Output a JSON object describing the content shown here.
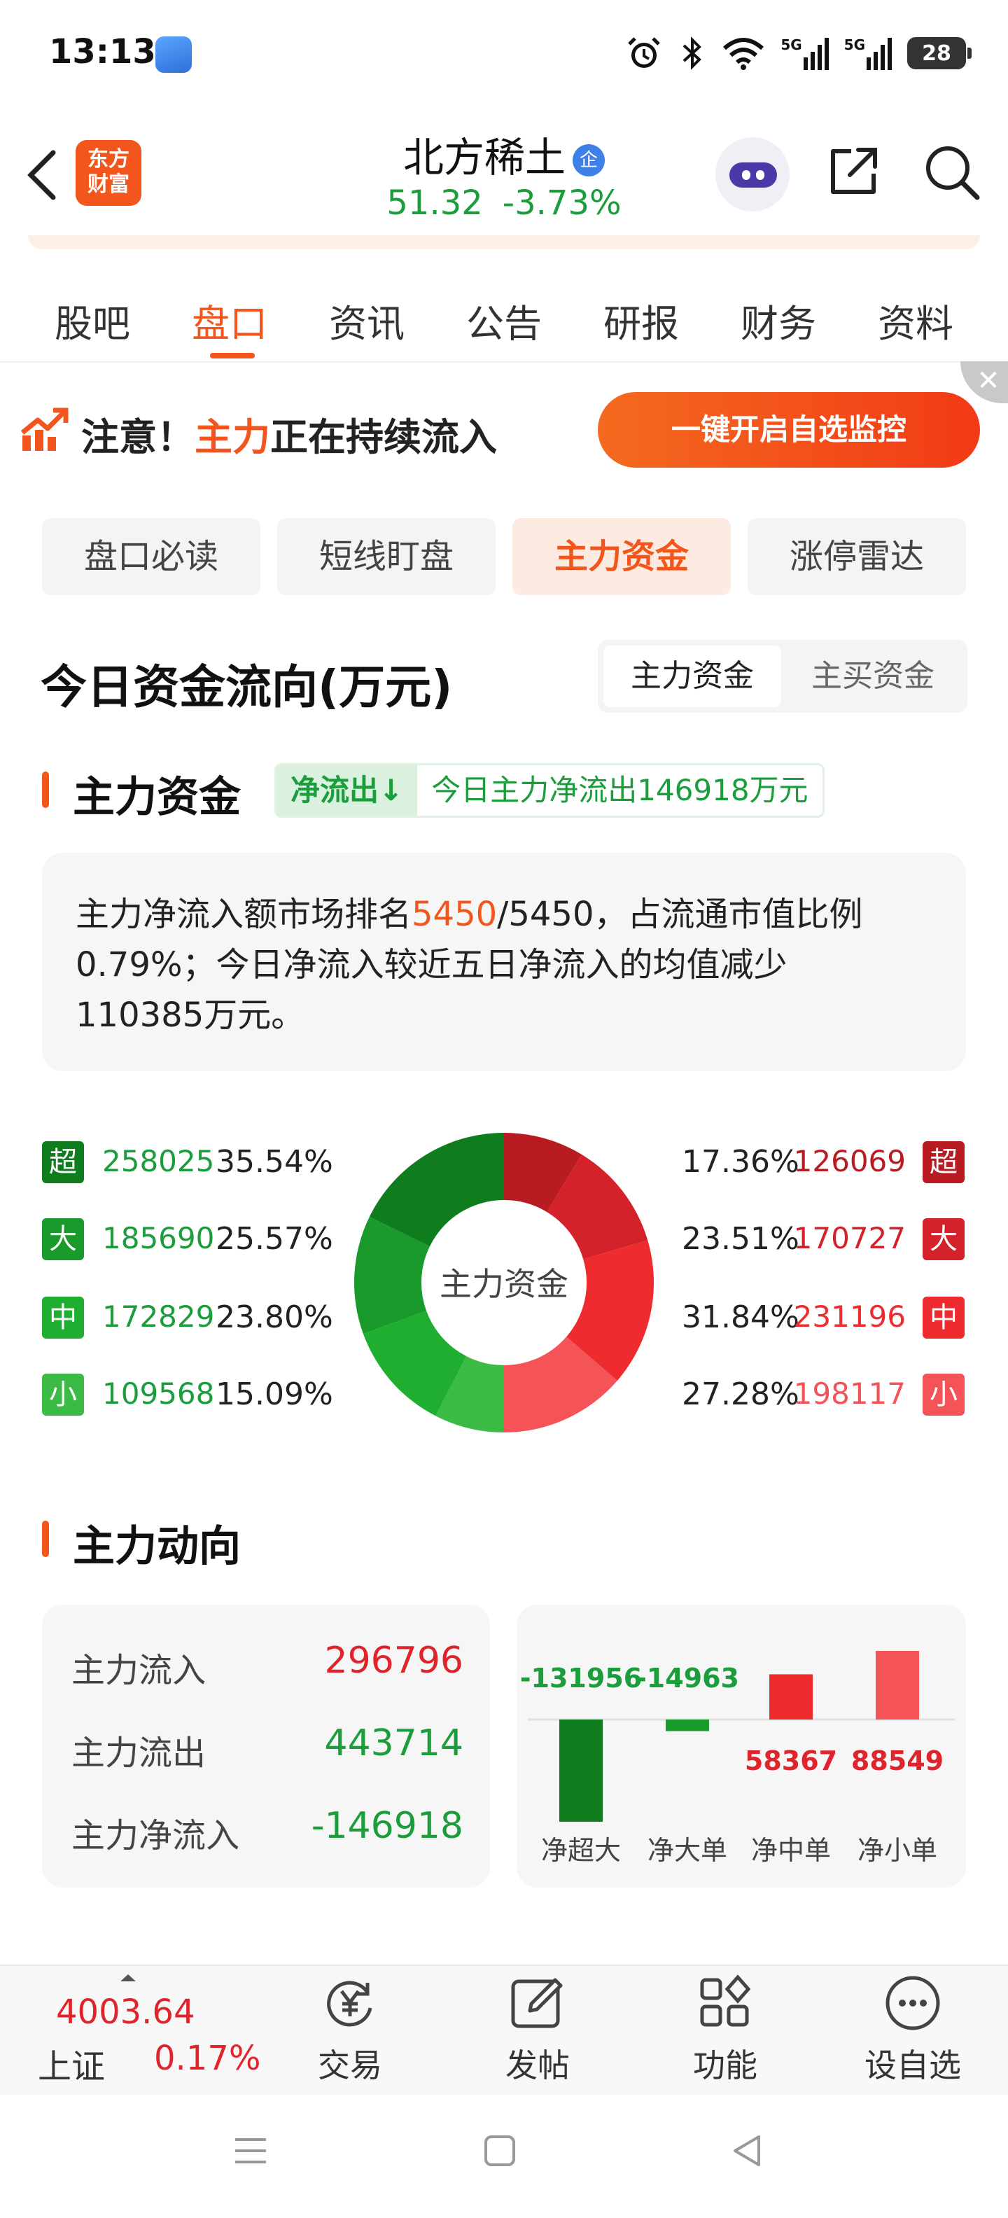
{
  "status_bar": {
    "time": "13:13",
    "battery": "28",
    "signal1": "5G",
    "signal2": "5G"
  },
  "header": {
    "logo_line1": "东方",
    "logo_line2": "财富",
    "stock_name": "北方稀土",
    "badge": "企",
    "price": "51.32",
    "change": "-3.73%"
  },
  "tabs": [
    "股吧",
    "盘口",
    "资讯",
    "公告",
    "研报",
    "财务",
    "资料"
  ],
  "notice": {
    "prefix": "注意！",
    "highlight": "主力",
    "suffix": "正在持续流入",
    "button": "一键开启自选监控",
    "close": "✕"
  },
  "subtabs": [
    "盘口必读",
    "短线盯盘",
    "主力资金",
    "涨停雷达"
  ],
  "flow": {
    "title": "今日资金流向(万元)",
    "toggle": [
      "主力资金",
      "主买资金"
    ]
  },
  "main_fund": {
    "title": "主力资金",
    "tag": "净流出",
    "tag_arrow": "↓",
    "tag_text": "今日主力净流出146918万元",
    "desc_part1": "主力净流入额市场排名",
    "rank": "5450",
    "desc_part2": "/5450，占流通市值比例",
    "desc_line2": "0.79%；今日净流入较近五日净流入的均值减少",
    "desc_line3": "110385万元。",
    "donut_center": "主力资金",
    "outflow": [
      {
        "label": "超",
        "value": "258025",
        "pct": "35.54%",
        "color": "#0f7d1e"
      },
      {
        "label": "大",
        "value": "185690",
        "pct": "25.57%",
        "color": "#1a9a2a"
      },
      {
        "label": "中",
        "value": "172829",
        "pct": "23.80%",
        "color": "#1fae30"
      },
      {
        "label": "小",
        "value": "109568",
        "pct": "15.09%",
        "color": "#3bbb45"
      }
    ],
    "inflow": [
      {
        "label": "超",
        "value": "126069",
        "pct": "17.36%",
        "color": "#b81c22"
      },
      {
        "label": "大",
        "value": "170727",
        "pct": "23.51%",
        "color": "#d4222a"
      },
      {
        "label": "中",
        "value": "231196",
        "pct": "31.84%",
        "color": "#ee2b2f"
      },
      {
        "label": "小",
        "value": "198117",
        "pct": "27.28%",
        "color": "#f45357"
      }
    ]
  },
  "trend": {
    "title": "主力动向",
    "rows": [
      {
        "label": "主力流入",
        "value": "296796",
        "color": "#e0242b"
      },
      {
        "label": "主力流出",
        "value": "443714",
        "color": "#1a9d3a"
      },
      {
        "label": "主力净流入",
        "value": "-146918",
        "color": "#1a9d3a"
      }
    ],
    "chart_data": {
      "type": "bar",
      "categories": [
        "净超大",
        "净大单",
        "净中单",
        "净小单"
      ],
      "values": [
        -131956,
        -14963,
        58367,
        88549
      ]
    }
  },
  "bottom_bar": {
    "index_value": "4003.64",
    "index_name": "上证",
    "index_pct": "0.17%",
    "items": [
      "交易",
      "发帖",
      "功能",
      "设自选"
    ]
  }
}
